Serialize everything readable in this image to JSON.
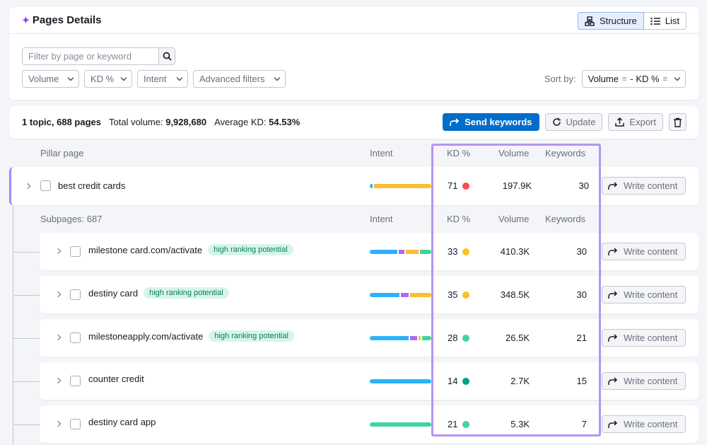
{
  "header": {
    "title": "Pages Details",
    "views": [
      {
        "label": "Structure",
        "active": true
      },
      {
        "label": "List",
        "active": false
      }
    ]
  },
  "filters": {
    "search_placeholder": "Filter by page or keyword",
    "dropdowns": [
      "Volume",
      "KD %",
      "Intent",
      "Advanced filters"
    ],
    "sort_label": "Sort by:",
    "sort_value_1": "Volume",
    "sort_sep": "- KD %"
  },
  "summary": {
    "topics_pages": "1 topic, 688 pages",
    "total_volume_label": "Total volume:",
    "total_volume": "9,928,680",
    "avg_kd_label": "Average KD:",
    "avg_kd": "54.53%",
    "send_keywords": "Send keywords",
    "update": "Update",
    "export": "Export"
  },
  "columns": {
    "pillar_page": "Pillar page",
    "intent": "Intent",
    "kd": "KD %",
    "volume": "Volume",
    "keywords": "Keywords",
    "subpages": "Subpages: 687"
  },
  "write_content_label": "Write content",
  "pillar": {
    "name": "best credit cards",
    "kd": "71",
    "kd_color": "#ff4953",
    "volume": "197.9K",
    "keywords": "30",
    "intent": [
      {
        "color": "#2cb2fa",
        "pct": 5
      },
      {
        "color": "#fbbd32",
        "pct": 95
      }
    ]
  },
  "subpages": [
    {
      "name": "milestone card.com/activate",
      "badge": "high ranking potential",
      "kd": "33",
      "kd_color": "#ffc024",
      "volume": "410.3K",
      "keywords": "30",
      "intent": [
        {
          "color": "#2cb2fa",
          "pct": 48
        },
        {
          "color": "#a96cf4",
          "pct": 10
        },
        {
          "color": "#fbbd32",
          "pct": 22
        },
        {
          "color": "#3ed59c",
          "pct": 20
        }
      ]
    },
    {
      "name": "destiny card",
      "badge": "high ranking potential",
      "kd": "35",
      "kd_color": "#ffc024",
      "volume": "348.5K",
      "keywords": "30",
      "intent": [
        {
          "color": "#2cb2fa",
          "pct": 50
        },
        {
          "color": "#a96cf4",
          "pct": 14
        },
        {
          "color": "#fbbd32",
          "pct": 36
        }
      ]
    },
    {
      "name": "milestoneapply.com/activate",
      "badge": "high ranking potential",
      "kd": "28",
      "kd_color": "#41d59d",
      "volume": "26.5K",
      "keywords": "21",
      "intent": [
        {
          "color": "#2cb2fa",
          "pct": 68
        },
        {
          "color": "#a96cf4",
          "pct": 12
        },
        {
          "color": "#fbbd32",
          "pct": 4
        },
        {
          "color": "#3ed59c",
          "pct": 16
        }
      ]
    },
    {
      "name": "counter credit",
      "badge": "",
      "kd": "14",
      "kd_color": "#009f81",
      "volume": "2.7K",
      "keywords": "15",
      "intent": [
        {
          "color": "#2cb2fa",
          "pct": 100
        }
      ]
    },
    {
      "name": "destiny card app",
      "badge": "",
      "kd": "21",
      "kd_color": "#41d59d",
      "volume": "5.3K",
      "keywords": "7",
      "intent": [
        {
          "color": "#3ed59c",
          "pct": 100
        }
      ]
    }
  ]
}
